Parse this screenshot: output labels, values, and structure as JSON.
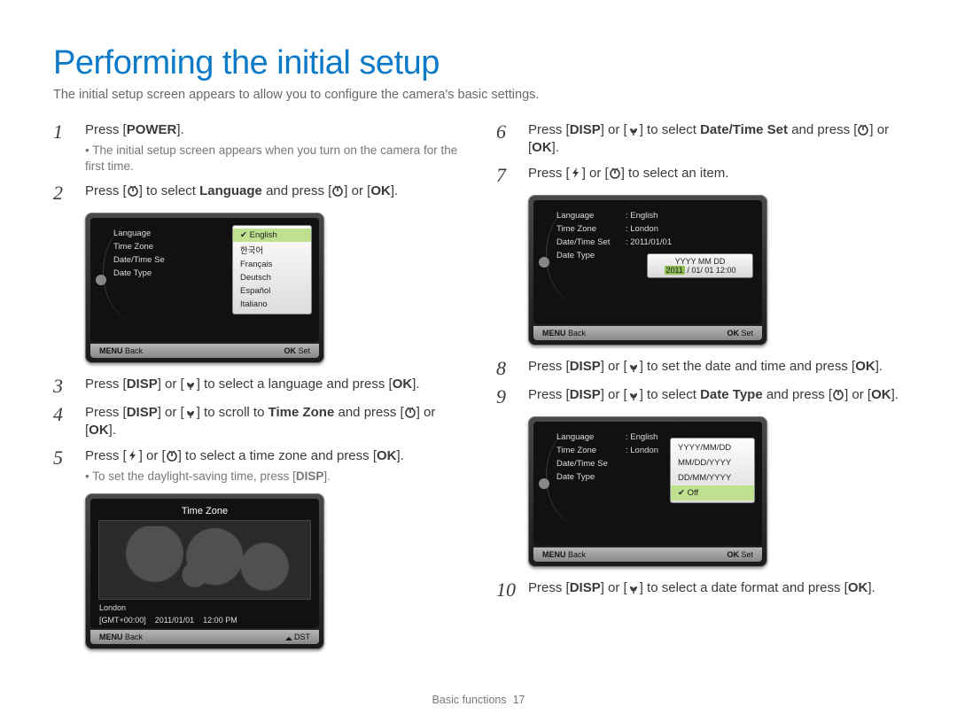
{
  "title": "Performing the initial setup",
  "intro": "The initial setup screen appears to allow you to configure the camera's basic settings.",
  "footer": {
    "section": "Basic functions",
    "page": "17"
  },
  "labels": {
    "power": "POWER",
    "disp": "DISP",
    "ok": "OK",
    "menu": "MENU",
    "back": "Back",
    "set": "Set",
    "dst": "DST"
  },
  "steps": {
    "s1": {
      "n": "1",
      "t1": "Press [",
      "t2": "].",
      "sub": "The initial setup screen appears when you turn on the camera for the first time."
    },
    "s2": {
      "n": "2",
      "t1": "Press [",
      "t2": "] to select ",
      "b1": "Language",
      "t3": " and press [",
      "t4": "] or [",
      "t5": "]."
    },
    "s3": {
      "n": "3",
      "t1": "Press [",
      "t2": "] or [",
      "t3": "] to select a language and press [",
      "t4": "]."
    },
    "s4": {
      "n": "4",
      "t1": "Press [",
      "t2": "] or [",
      "t3": "] to scroll to ",
      "b1": "Time Zone",
      "t4": " and press [",
      "t5": "] or [",
      "t6": "]."
    },
    "s5": {
      "n": "5",
      "t1": "Press [",
      "t2": "] or [",
      "t3": "] to select a time zone and press [",
      "t4": "].",
      "sub": "To set the daylight-saving time, press [",
      "sub2": "]."
    },
    "s6": {
      "n": "6",
      "t1": "Press [",
      "t2": "] or [",
      "t3": "] to select ",
      "b1": "Date/Time Set",
      "t4": " and press [",
      "t5": "] or [",
      "t6": "]."
    },
    "s7": {
      "n": "7",
      "t1": "Press [",
      "t2": "] or [",
      "t3": "] to select an item."
    },
    "s8": {
      "n": "8",
      "t1": "Press [",
      "t2": "] or [",
      "t3": "] to set the date and time and press [",
      "t4": "]."
    },
    "s9": {
      "n": "9",
      "t1": "Press [",
      "t2": "] or [",
      "t3": "] to select ",
      "b1": "Date Type",
      "t4": " and press [",
      "t5": "] or [",
      "t6": "]."
    },
    "s10": {
      "n": "10",
      "t1": "Press [",
      "t2": "] or [",
      "t3": "] to select a date format and press [",
      "t4": "]."
    }
  },
  "screen_lang": {
    "rows": [
      {
        "label": "Language"
      },
      {
        "label": "Time Zone"
      },
      {
        "label": "Date/Time Se"
      },
      {
        "label": "Date Type"
      }
    ],
    "popup": [
      "English",
      "한국어",
      "Français",
      "Deutsch",
      "Español",
      "Italiano"
    ]
  },
  "screen_tz": {
    "title": "Time Zone",
    "city": "London",
    "gmt": "[GMT+00:00]",
    "date": "2011/01/01",
    "time": "12:00 PM"
  },
  "screen_dt": {
    "rows": [
      {
        "label": "Language",
        "val": ": English"
      },
      {
        "label": "Time Zone",
        "val": ": London"
      },
      {
        "label": "Date/Time Set",
        "val": ": 2011/01/01"
      },
      {
        "label": "Date Type",
        "val": ""
      }
    ],
    "box_hdr": "YYYY MM DD",
    "box_year": "2011",
    "box_rest": "/ 01/ 01  12:00"
  },
  "screen_type": {
    "rows": [
      {
        "label": "Language",
        "val": ": English"
      },
      {
        "label": "Time Zone",
        "val": ": London"
      },
      {
        "label": "Date/Time Se",
        "val": ""
      },
      {
        "label": "Date Type",
        "val": ""
      }
    ],
    "popup": [
      "YYYY/MM/DD",
      "MM/DD/YYYY",
      "DD/MM/YYYY",
      "Off"
    ]
  }
}
